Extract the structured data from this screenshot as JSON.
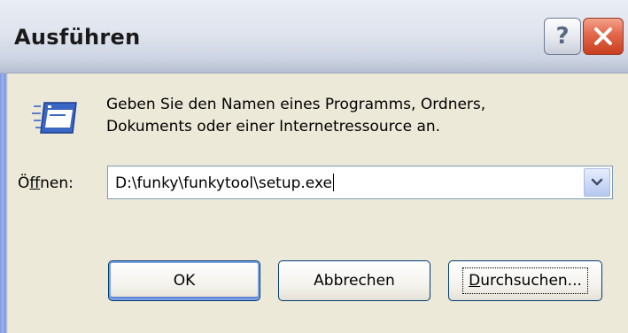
{
  "window": {
    "title": "Ausführen",
    "help_icon": "question-mark-icon",
    "close_icon": "close-x-icon"
  },
  "description": {
    "line1": "Geben Sie den Namen eines Programms, Ordners,",
    "line2": "Dokuments oder einer Internetressource an.",
    "icon": "run-dialog-icon"
  },
  "open_field": {
    "label_prefix": "Ö",
    "label_accel": "f",
    "label_rest": "fnen:",
    "value": "D:\\funky\\funkytool\\setup.exe",
    "dropdown_icon": "chevron-down-icon"
  },
  "buttons": {
    "ok": "OK",
    "cancel": "Abbrechen",
    "browse_accel": "D",
    "browse_rest": "urchsuchen..."
  },
  "colors": {
    "dialog_bg": "#ece9d8",
    "close_red": "#e2664a",
    "button_border": "#003c74",
    "field_border": "#7f9db9"
  }
}
